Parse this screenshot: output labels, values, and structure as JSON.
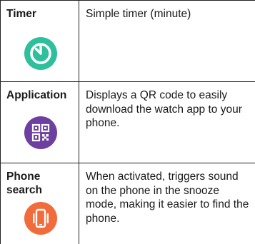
{
  "rows": [
    {
      "name": "Timer",
      "icon": "timer-icon",
      "icon_color": "#2ebf9c",
      "description": "Simple timer (minute)"
    },
    {
      "name": "Application",
      "icon": "qr-code-icon",
      "icon_color": "#6d3fa0",
      "description": "Displays a QR code to easily download the watch app to your phone."
    },
    {
      "name": "Phone search",
      "icon": "phone-vibrate-icon",
      "icon_color": "#f26b3a",
      "description": "When activated, triggers sound on the phone in the snooze mode, making it easier to find the phone."
    }
  ]
}
